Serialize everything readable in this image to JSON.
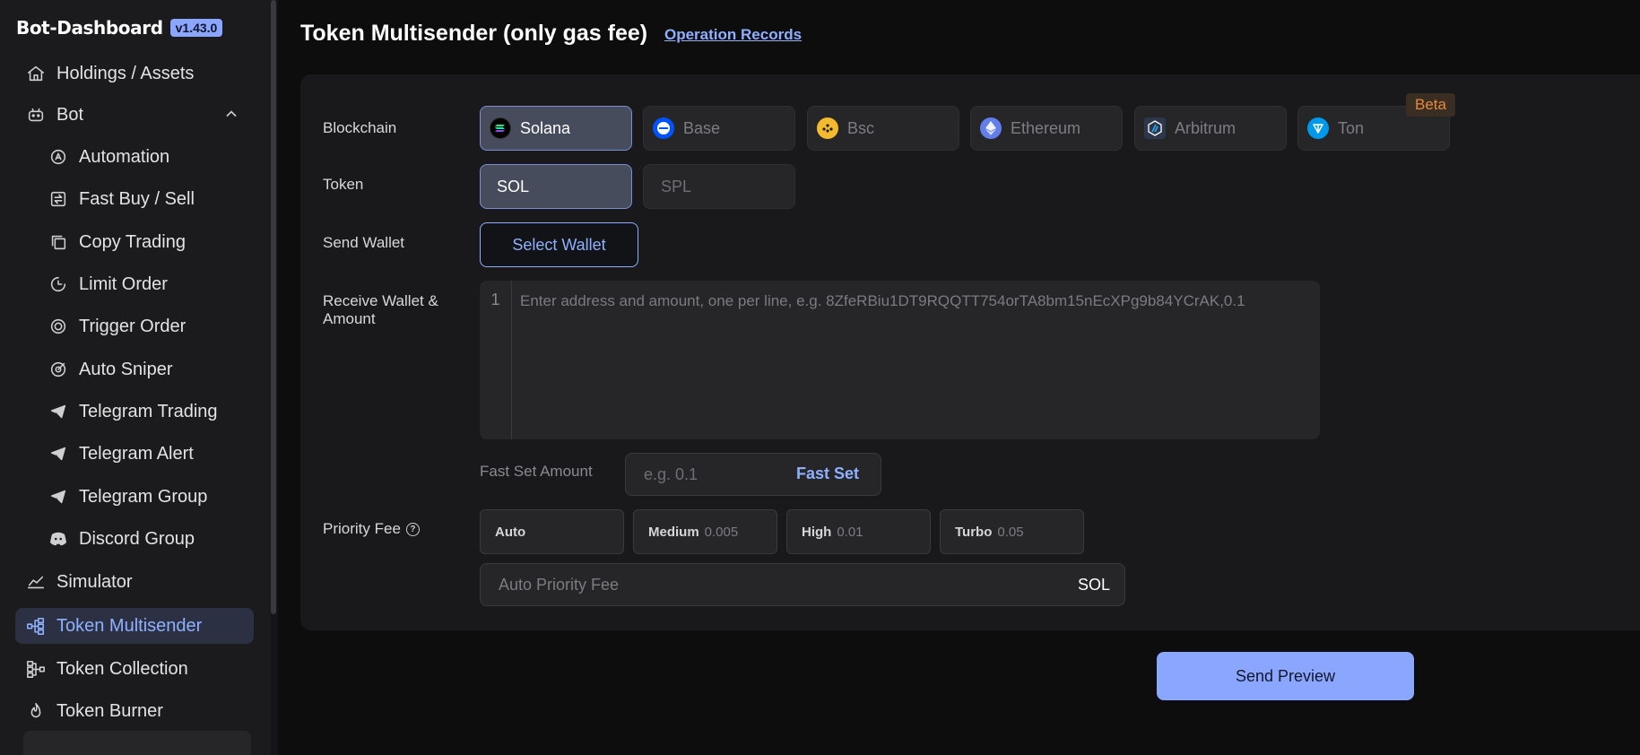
{
  "sidebar": {
    "logo": "Bot-Dashboard",
    "version": "v1.43.0",
    "items": [
      {
        "label": "Holdings / Assets"
      },
      {
        "label": "Bot"
      },
      {
        "label": "Automation"
      },
      {
        "label": "Fast Buy / Sell"
      },
      {
        "label": "Copy Trading"
      },
      {
        "label": "Limit Order"
      },
      {
        "label": "Trigger Order"
      },
      {
        "label": "Auto Sniper"
      },
      {
        "label": "Telegram Trading"
      },
      {
        "label": "Telegram Alert"
      },
      {
        "label": "Telegram Group"
      },
      {
        "label": "Discord Group"
      },
      {
        "label": "Simulator"
      },
      {
        "label": "Token Multisender"
      },
      {
        "label": "Token Collection"
      },
      {
        "label": "Token Burner"
      }
    ]
  },
  "header": {
    "title": "Token Multisender (only gas fee)",
    "link": "Operation Records"
  },
  "form": {
    "blockchain_label": "Blockchain",
    "chains": [
      {
        "label": "Solana",
        "active": true
      },
      {
        "label": "Base"
      },
      {
        "label": "Bsc"
      },
      {
        "label": "Ethereum"
      },
      {
        "label": "Arbitrum"
      },
      {
        "label": "Ton"
      }
    ],
    "beta": "Beta",
    "token_label": "Token",
    "tokens": [
      {
        "label": "SOL",
        "active": true
      },
      {
        "label": "SPL"
      }
    ],
    "send_wallet_label": "Send Wallet",
    "select_wallet": "Select Wallet",
    "receive_label": "Receive Wallet & Amount",
    "line_number": "1",
    "receive_placeholder": "Enter address and amount, one per line, e.g. 8ZfeRBiu1DT9RQQTT754orTA8bm15nEcXPg9b84YCrAK,0.1",
    "fast_set_label": "Fast Set Amount",
    "fast_set_placeholder": "e.g. 0.1",
    "fast_set_button": "Fast Set",
    "priority_fee_label": "Priority Fee",
    "help": "?",
    "fees": [
      {
        "name": "Auto",
        "value": ""
      },
      {
        "name": "Medium",
        "value": "0.005"
      },
      {
        "name": "High",
        "value": "0.01"
      },
      {
        "name": "Turbo",
        "value": "0.05"
      }
    ],
    "auto_fee_placeholder": "Auto Priority Fee",
    "fee_unit": "SOL"
  },
  "actions": {
    "send_preview": "Send Preview"
  },
  "colors": {
    "accent": "#8aa6ff",
    "beta": "#e58a3c",
    "solana": "#14f195",
    "base": "#0052ff",
    "bsc": "#f3ba2f",
    "ethereum": "#627eea",
    "arbitrum": "#28a0f0",
    "ton": "#0098ea"
  }
}
